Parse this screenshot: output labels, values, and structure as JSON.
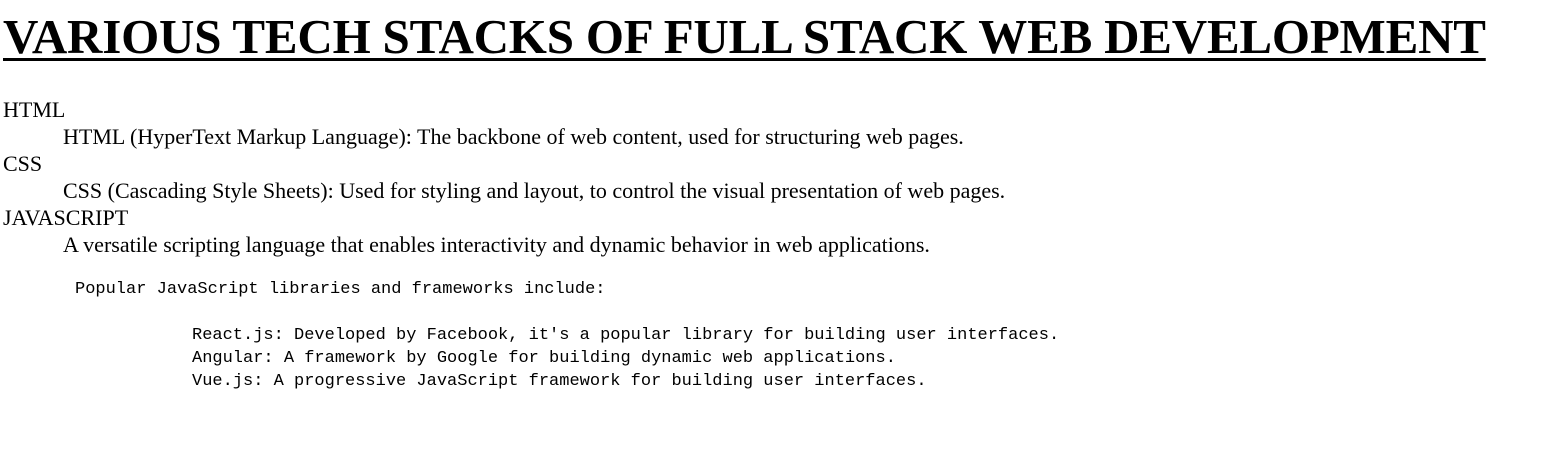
{
  "page": {
    "title": "VARIOUS TECH STACKS OF FULL STACK WEB DEVELOPMENT"
  },
  "stacks": [
    {
      "term": "HTML",
      "definition": "HTML (HyperText Markup Language): The backbone of web content, used for structuring web pages."
    },
    {
      "term": "CSS",
      "definition": "CSS (Cascading Style Sheets): Used for styling and layout, to control the visual presentation of web pages."
    },
    {
      "term": "JAVASCRIPT",
      "definition": "A versatile scripting language that enables interactivity and dynamic behavior in web applications."
    }
  ],
  "javascript_section": {
    "intro": "Popular JavaScript libraries and frameworks include:",
    "frameworks": [
      "React.js: Developed by Facebook, it's a popular library for building user interfaces.",
      "Angular: A framework by Google for building dynamic web applications.",
      "Vue.js: A progressive JavaScript framework for building user interfaces."
    ]
  }
}
